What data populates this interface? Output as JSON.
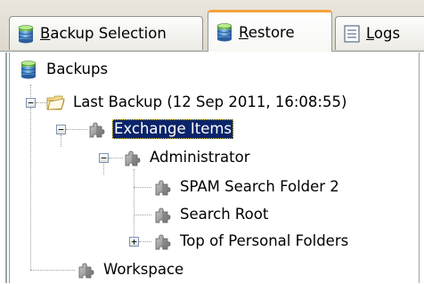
{
  "tabs": [
    {
      "prefix": "",
      "mnemonic": "B",
      "rest": "ackup Selection",
      "icon": "database-icon",
      "active": false
    },
    {
      "prefix": "",
      "mnemonic": "R",
      "rest": "estore",
      "icon": "database-icon",
      "active": true
    },
    {
      "prefix": "",
      "mnemonic": "L",
      "rest": "ogs",
      "icon": "log-document-icon",
      "active": false
    }
  ],
  "tree": {
    "root": {
      "label": "Backups",
      "icon": "database-icon"
    },
    "last_backup": {
      "label": "Last Backup (12 Sep 2011, 16:08:55)",
      "icon": "folder-open-icon",
      "expander": "−"
    },
    "exchange_items": {
      "label": "Exchange Items",
      "icon": "puzzle-icon",
      "expander": "−",
      "selected": true
    },
    "administrator": {
      "label": "Administrator",
      "icon": "puzzle-icon",
      "expander": "−"
    },
    "spam_folder": {
      "label": "SPAM Search Folder 2",
      "icon": "puzzle-icon"
    },
    "search_root": {
      "label": "Search Root",
      "icon": "puzzle-icon"
    },
    "top_personal": {
      "label": "Top of Personal Folders",
      "icon": "puzzle-icon",
      "expander": "+"
    },
    "workspace": {
      "label": "Workspace",
      "icon": "puzzle-icon"
    }
  },
  "colors": {
    "selection_bg": "#0a246a",
    "active_tab_accent": "#f3a33a",
    "tree_lines": "#a0a0a0"
  }
}
